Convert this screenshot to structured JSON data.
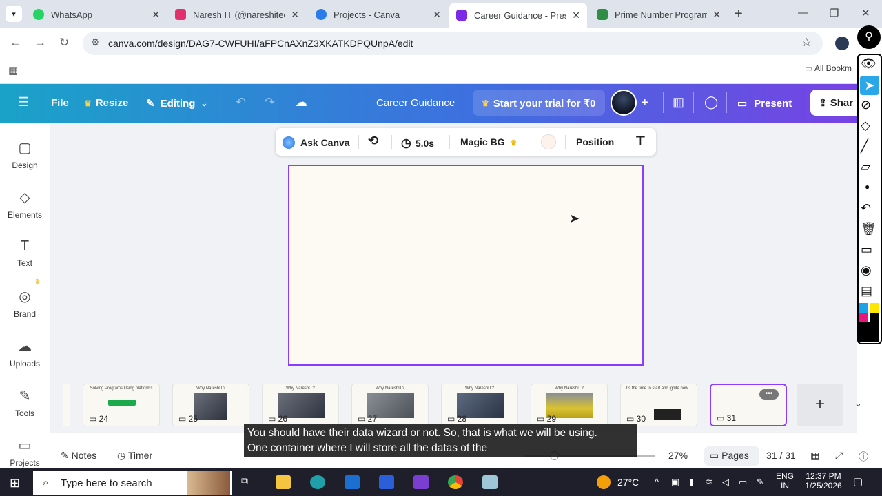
{
  "browser": {
    "tabs": [
      {
        "title": "WhatsApp",
        "fav_color": "#25d366"
      },
      {
        "title": "Naresh IT (@nareshitech",
        "fav_color": "#e1306c"
      },
      {
        "title": "Projects - Canva",
        "fav_color": "#2b7ce9"
      },
      {
        "title": "Career Guidance - Preser",
        "fav_color": "#7d2ae8"
      },
      {
        "title": "Prime Number Program",
        "fav_color": "#2f8d46"
      }
    ],
    "active_tab_index": 3,
    "url": "canva.com/design/DAG7-CWFUHI/aFPCnAXnZ3XKATKDPQUnpA/edit",
    "bookmarks_label": "All Bookm"
  },
  "canva_bar": {
    "file": "File",
    "resize": "Resize",
    "editing": "Editing",
    "title": "Career Guidance",
    "trial": "Start your trial for ₹0",
    "present": "Present",
    "share": "Shar"
  },
  "sidebar": {
    "items": [
      {
        "label": "Design",
        "icon": "▢"
      },
      {
        "label": "Elements",
        "icon": "◇"
      },
      {
        "label": "Text",
        "icon": "T"
      },
      {
        "label": "Brand",
        "icon": "◎"
      },
      {
        "label": "Uploads",
        "icon": "☁"
      },
      {
        "label": "Tools",
        "icon": "✎"
      },
      {
        "label": "Projects",
        "icon": "▭"
      }
    ]
  },
  "context_toolbar": {
    "ask": "Ask Canva",
    "duration": "5.0s",
    "magic_bg": "Magic BG",
    "position": "Position"
  },
  "pages": {
    "thumbnails": [
      {
        "num": "24",
        "caption": "Solving Programs Using platforms"
      },
      {
        "num": "25",
        "caption": "Why NareshIT?"
      },
      {
        "num": "26",
        "caption": "Why NareshIT?"
      },
      {
        "num": "27",
        "caption": "Why NareshIT?"
      },
      {
        "num": "28",
        "caption": "Why NareshIT?"
      },
      {
        "num": "29",
        "caption": "Why NareshIT?"
      },
      {
        "num": "30",
        "caption": "Its the time to start and ignite now..."
      },
      {
        "num": "31",
        "caption": ""
      }
    ]
  },
  "bottom_bar": {
    "notes": "Notes",
    "timer": "Timer",
    "zoom": "27%",
    "pages": "Pages",
    "page_count": "31 / 31"
  },
  "caption": {
    "line1": "You should have their data wizard or not. So, that is what we will be using.",
    "line2": "One container where I will store all the datas of the"
  },
  "taskbar": {
    "search_placeholder": "Type here to search",
    "temperature": "27°C",
    "lang1": "ENG",
    "lang2": "IN",
    "time": "12:37 PM",
    "date": "1/25/2026"
  }
}
